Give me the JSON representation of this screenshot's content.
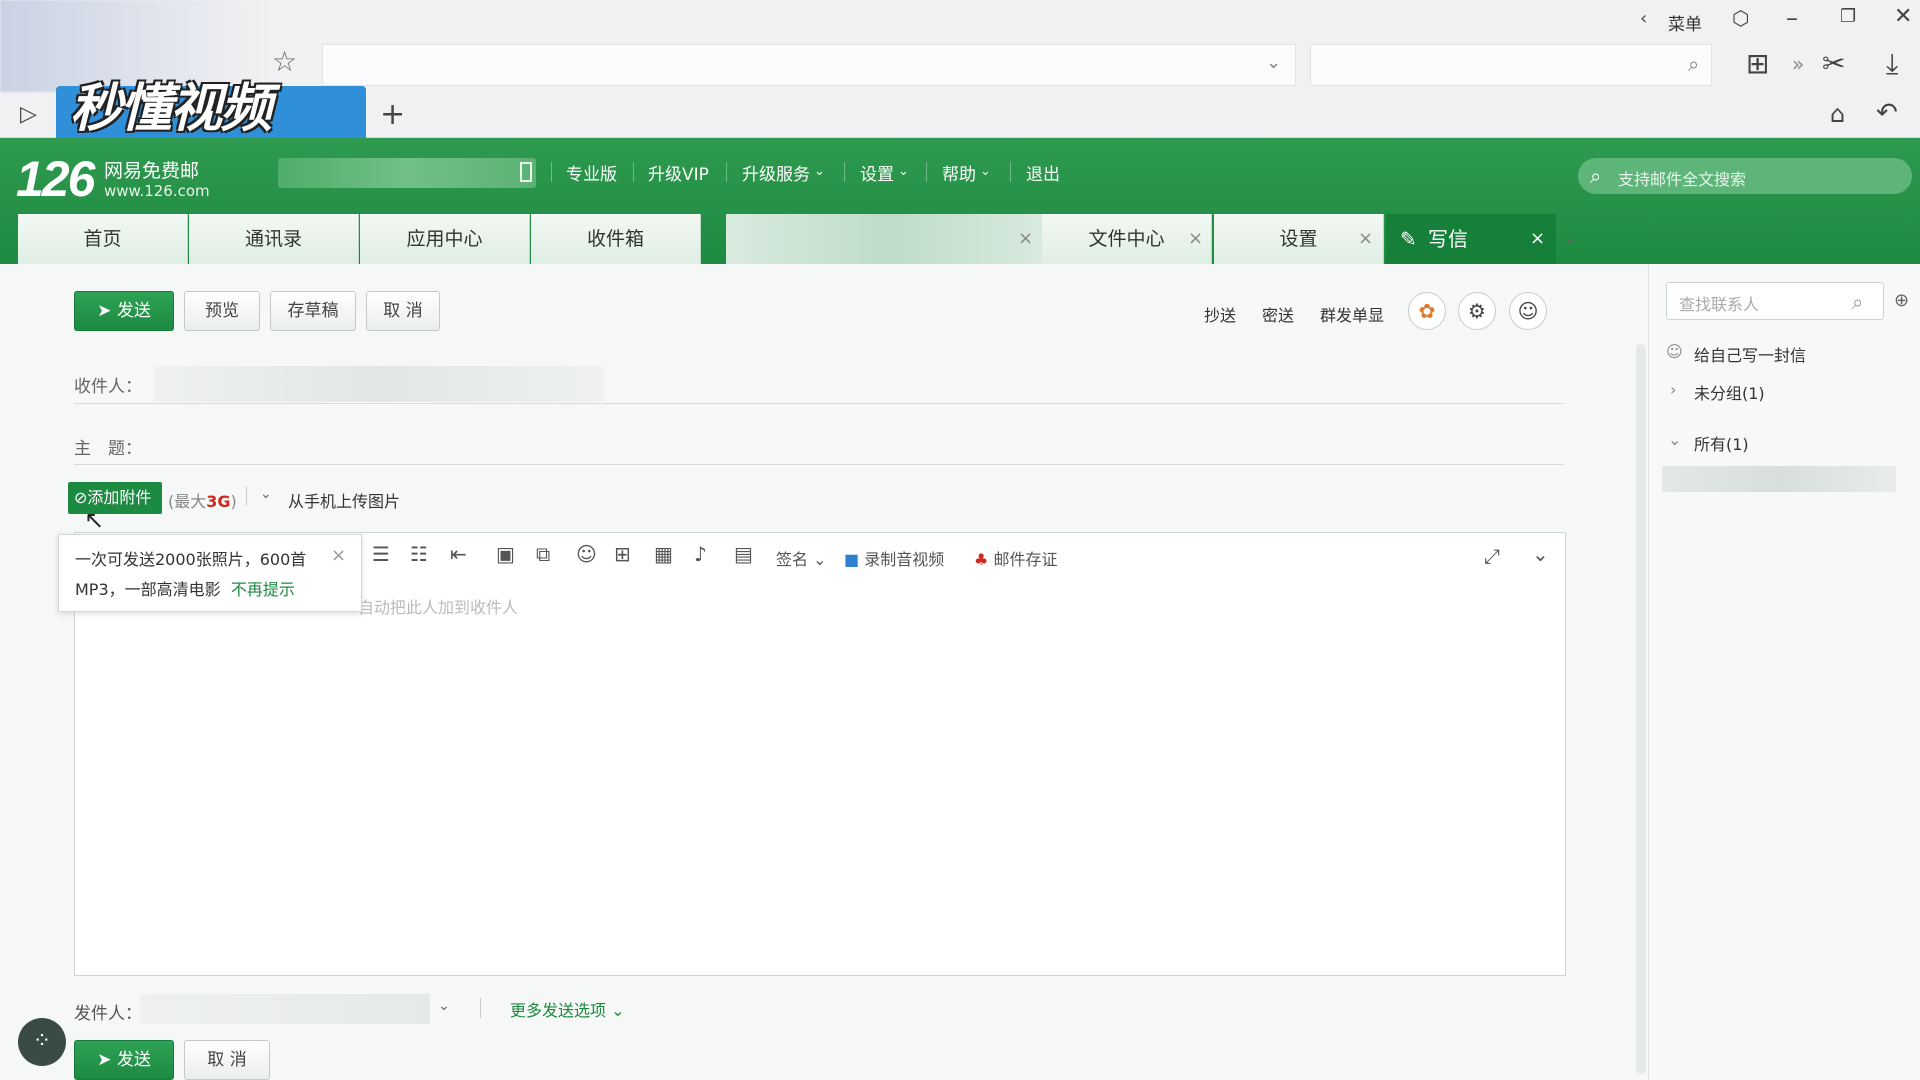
{
  "browser": {
    "menu_label": "菜单",
    "watermark": "秒懂视频"
  },
  "brand": {
    "number": "126",
    "name": "网易免费邮",
    "url": "www.126.com"
  },
  "topnav": [
    "专业版",
    "升级VIP",
    "升级服务",
    "设置",
    "帮助",
    "退出"
  ],
  "fulltext_search_placeholder": "支持邮件全文搜索",
  "tabs": {
    "home": "首页",
    "contacts": "通讯录",
    "apps": "应用中心",
    "inbox": "收件箱",
    "files": "文件中心",
    "settings": "设置",
    "compose": "写信"
  },
  "toolbar": {
    "send": "发送",
    "preview": "预览",
    "draft": "存草稿",
    "cancel": "取 消",
    "cc": "抄送",
    "bcc": "密送",
    "separate": "群发单显"
  },
  "fields": {
    "to_label": "收件人：",
    "subject_label": "主　题：",
    "attach": "添加附件",
    "attach_limit_prefix": "(最大",
    "attach_limit_value": "3G",
    "attach_limit_suffix": ")",
    "upload_mobile": "从手机上传图片",
    "from_label": "发件人：",
    "more_options": "更多发送选项"
  },
  "tooltip": {
    "line1": "一次可发送2000张照片，600首",
    "line2": "MP3，一部高清电影",
    "dismiss": "不再提示"
  },
  "editor": {
    "signature": "签名",
    "record": "录制音视频",
    "evidence": "邮件存证",
    "hint": "自动把此人加到收件人"
  },
  "footer": {
    "send": "发送",
    "cancel": "取 消"
  },
  "sidebar": {
    "search_placeholder": "查找联系人",
    "write_self": "给自己写一封信",
    "ungrouped": "未分组(1)",
    "all": "所有(1)"
  },
  "colors": {
    "brand_green": "#1f8a41",
    "accent_red": "#d0281e"
  }
}
